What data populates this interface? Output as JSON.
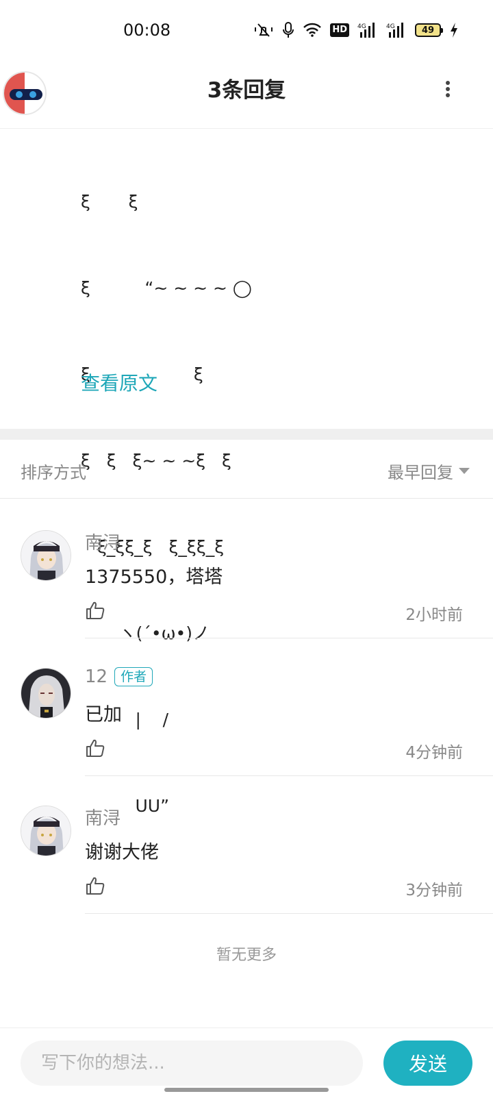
{
  "status_bar": {
    "time": "00:08",
    "hd_label": "HD",
    "network_1": "4G",
    "network_2": "4G",
    "battery_level": "49"
  },
  "header": {
    "title": "3条回复"
  },
  "original_post": {
    "ascii_lines": [
      "ξ       ξ",
      "ξ          “~ ~ ~ ~ ◯",
      "ξ                   ξ",
      "ξ   ξ   ξ~ ~ ~ξ   ξ",
      "   ξ_ξξ_ξ   ξ_ξξ_ξ",
      "       ヽ(´•ω•)ノ",
      "          |    /",
      "          UU”"
    ],
    "view_original_label": "查看原文"
  },
  "sort": {
    "label": "排序方式",
    "selected": "最早回复"
  },
  "replies": [
    {
      "user": "南浔",
      "is_author": false,
      "text": "1375550，塔塔",
      "time": "2小时前"
    },
    {
      "user": "12",
      "is_author": true,
      "author_tag": "作者",
      "text": "已加",
      "time": "4分钟前"
    },
    {
      "user": "南浔",
      "is_author": false,
      "text": "谢谢大佬",
      "time": "3分钟前"
    }
  ],
  "no_more_text": "暂无更多",
  "input": {
    "placeholder": "写下你的想法...",
    "send_label": "发送"
  },
  "colors": {
    "accent": "#1fb1c1",
    "link": "#1fa7b8",
    "muted_text": "#888888"
  },
  "icons": [
    "mute-icon",
    "mic-icon",
    "wifi-icon",
    "signal-icon",
    "battery-icon",
    "charging-icon",
    "more-icon",
    "thumbs-up-icon",
    "caret-down-icon"
  ]
}
